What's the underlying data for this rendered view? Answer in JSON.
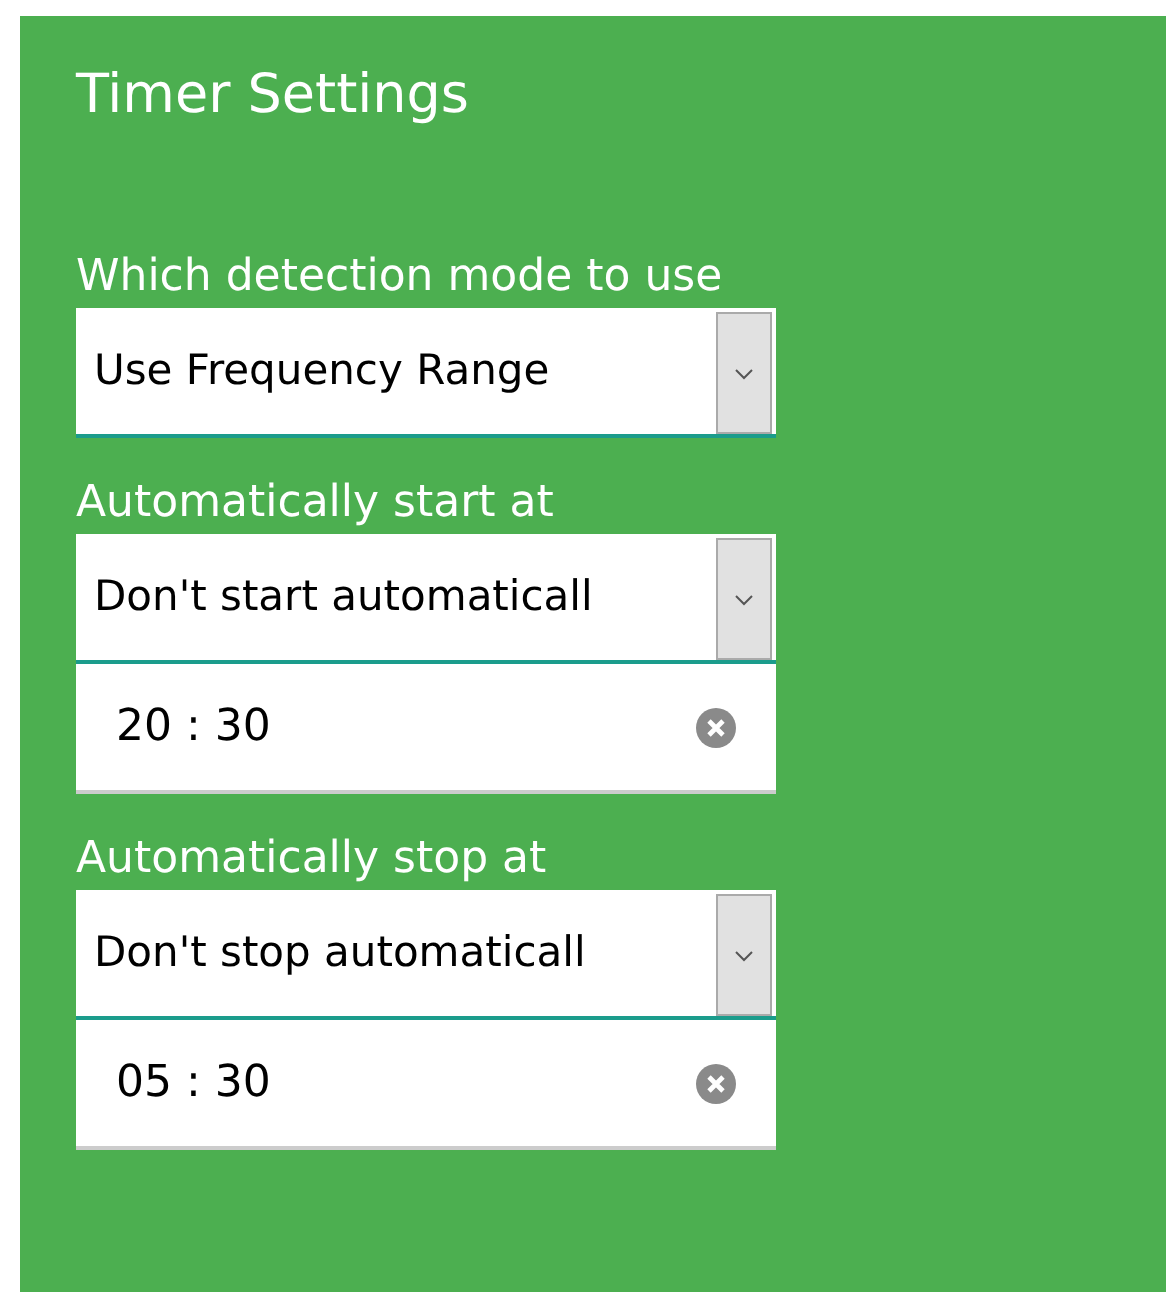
{
  "title": "Timer Settings",
  "sections": [
    {
      "label": "Which detection mode to use",
      "select": {
        "value": "Use Frequency Range"
      }
    },
    {
      "label": "Automatically start at",
      "select": {
        "value": "Don't start automaticall"
      },
      "time": {
        "value": "20 : 30"
      }
    },
    {
      "label": "Automatically stop at",
      "select": {
        "value": "Don't stop automaticall"
      },
      "time": {
        "value": "05 : 30"
      }
    }
  ]
}
